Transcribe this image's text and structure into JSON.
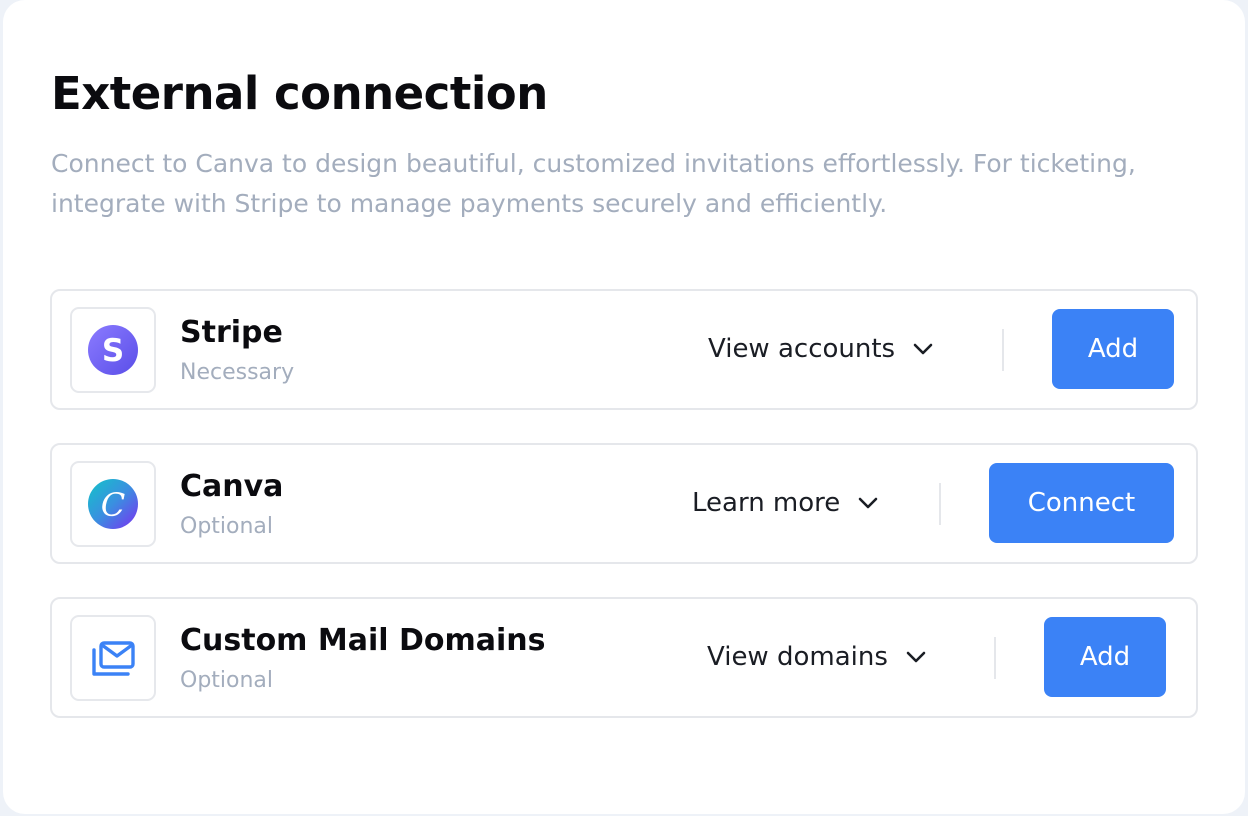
{
  "header": {
    "title": "External connection",
    "description": "Connect to Canva to design beautiful, customized invitations effortlessly. For ticketing, integrate with Stripe to manage payments securely and efficiently."
  },
  "connections": [
    {
      "name": "Stripe",
      "status": "Necessary",
      "icon": "stripe-logo-icon",
      "dropdown_label": "View accounts",
      "button_label": "Add"
    },
    {
      "name": "Canva",
      "status": "Optional",
      "icon": "canva-logo-icon",
      "dropdown_label": "Learn more",
      "button_label": "Connect"
    },
    {
      "name": "Custom Mail Domains",
      "status": "Optional",
      "icon": "mail-domains-icon",
      "dropdown_label": "View domains",
      "button_label": "Add"
    }
  ],
  "colors": {
    "primary_button": "#3b82f6",
    "muted_text": "#a3adbd",
    "stripe_purple": "#635bff",
    "mail_icon_blue": "#3b82f6"
  }
}
